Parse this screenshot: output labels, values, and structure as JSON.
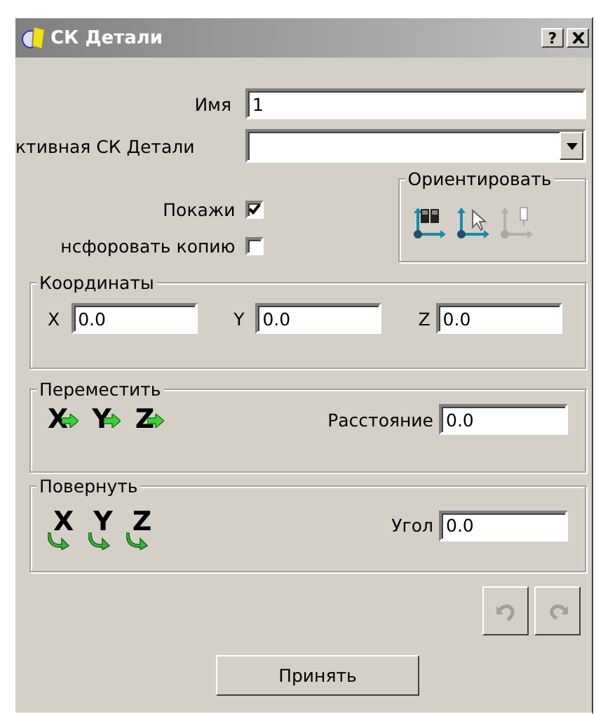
{
  "window": {
    "title": "СК Детали",
    "help_button": "?"
  },
  "name_field": {
    "label": "Имя",
    "value": "1"
  },
  "active_cs": {
    "label": "ктивная СК Детали"
  },
  "checkboxes": [
    {
      "label": "Покажи",
      "checked": true
    },
    {
      "label": "нсфоровать копию",
      "checked": false
    }
  ],
  "orient": {
    "title": "Ориентировать",
    "buttons": [
      {
        "kind": "binoculars",
        "disabled": false
      },
      {
        "kind": "pointer",
        "disabled": false
      },
      {
        "kind": "tool",
        "disabled": true
      }
    ]
  },
  "coordinates": {
    "title": "Координаты",
    "fields": [
      {
        "label": "X",
        "value": "0.0"
      },
      {
        "label": "Y",
        "value": "0.0"
      },
      {
        "label": "Z",
        "value": "0.0"
      }
    ]
  },
  "move": {
    "title": "Переместить",
    "axes": [
      "X",
      "Y",
      "Z"
    ],
    "distance": {
      "label": "Расстояние",
      "value": "0.0"
    }
  },
  "rotate": {
    "title": "Повернуть",
    "axes": [
      "X",
      "Y",
      "Z"
    ],
    "angle": {
      "label": "Угол",
      "value": "0.0"
    }
  },
  "history": [
    {
      "kind": "undo",
      "disabled": true
    },
    {
      "kind": "redo",
      "disabled": true
    }
  ],
  "accept_button": "Принять"
}
